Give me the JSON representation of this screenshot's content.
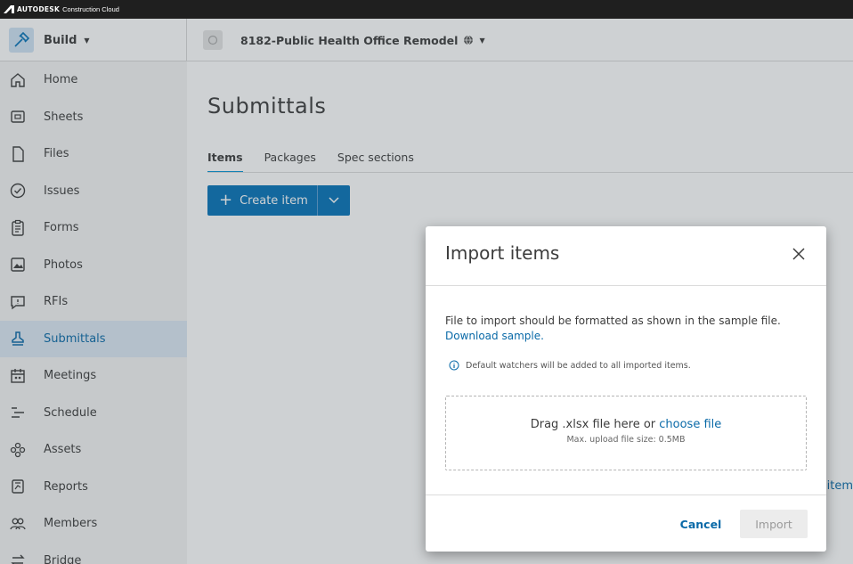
{
  "brand": {
    "name": "AUTODESK",
    "product": "Construction Cloud"
  },
  "header": {
    "module_label": "Build",
    "project_name": "8182-Public Health Office Remodel"
  },
  "sidebar": {
    "items": [
      {
        "label": "Home",
        "icon": "home-icon"
      },
      {
        "label": "Sheets",
        "icon": "sheets-icon"
      },
      {
        "label": "Files",
        "icon": "file-icon"
      },
      {
        "label": "Issues",
        "icon": "check-circle-icon"
      },
      {
        "label": "Forms",
        "icon": "clipboard-icon"
      },
      {
        "label": "Photos",
        "icon": "photo-icon"
      },
      {
        "label": "RFIs",
        "icon": "speech-bubble-icon"
      },
      {
        "label": "Submittals",
        "icon": "stamp-icon"
      },
      {
        "label": "Meetings",
        "icon": "calendar-people-icon"
      },
      {
        "label": "Schedule",
        "icon": "schedule-icon"
      },
      {
        "label": "Assets",
        "icon": "assets-icon"
      },
      {
        "label": "Reports",
        "icon": "report-icon"
      },
      {
        "label": "Members",
        "icon": "members-icon"
      },
      {
        "label": "Bridge",
        "icon": "bridge-icon"
      }
    ],
    "active_index": 7
  },
  "main": {
    "title": "Submittals",
    "tabs": [
      "Items",
      "Packages",
      "Spec sections"
    ],
    "create_label": "Create item",
    "partial_text": "item"
  },
  "modal": {
    "title": "Import items",
    "description": "File to import should be formatted as shown in the sample file.",
    "download_link": "Download sample.",
    "info_text": "Default watchers will be added to all imported items.",
    "drop_text": "Drag .xlsx file here or",
    "choose_file": "choose file",
    "max_size": "Max. upload file size: 0.5MB",
    "cancel_label": "Cancel",
    "import_label": "Import"
  },
  "colors": {
    "accent": "#0696d7",
    "primary_button": "#0673b8",
    "link": "#0a6aa8",
    "active_nav_bg": "#dce9f5"
  }
}
